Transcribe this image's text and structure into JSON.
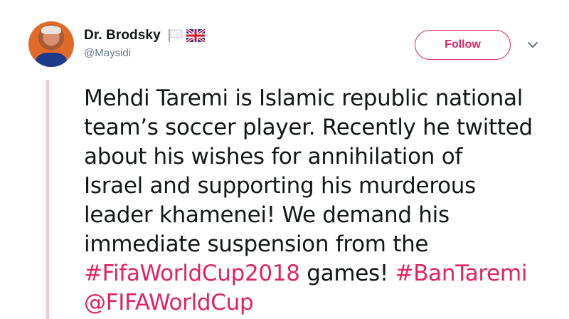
{
  "author": {
    "display_name": "Dr. Brodsky",
    "handle": "@Maysidi",
    "flags": [
      "white-flag-icon",
      "uk-flag-icon"
    ]
  },
  "follow_button": {
    "label": "Follow"
  },
  "menu": {
    "icon": "chevron-down-icon"
  },
  "tweet": {
    "lines": [
      "Mehdi Taremi is Islamic republic national",
      "team’s soccer player. Recently he twitted",
      "about his wishes  for annihilation of",
      "Israel and supporting his murderous",
      "leader khamenei! We demand his",
      "immediate suspension from the"
    ],
    "line7": {
      "hashtag1": "#FifaWorldCup2018",
      "text": " games! ",
      "hashtag2": "#BanTaremi"
    },
    "mention": "@FIFAWorldCup"
  },
  "colors": {
    "accent": "#e0245e",
    "text": "#14171a",
    "secondary": "#657786",
    "thread_line": "#f3c6d3"
  }
}
